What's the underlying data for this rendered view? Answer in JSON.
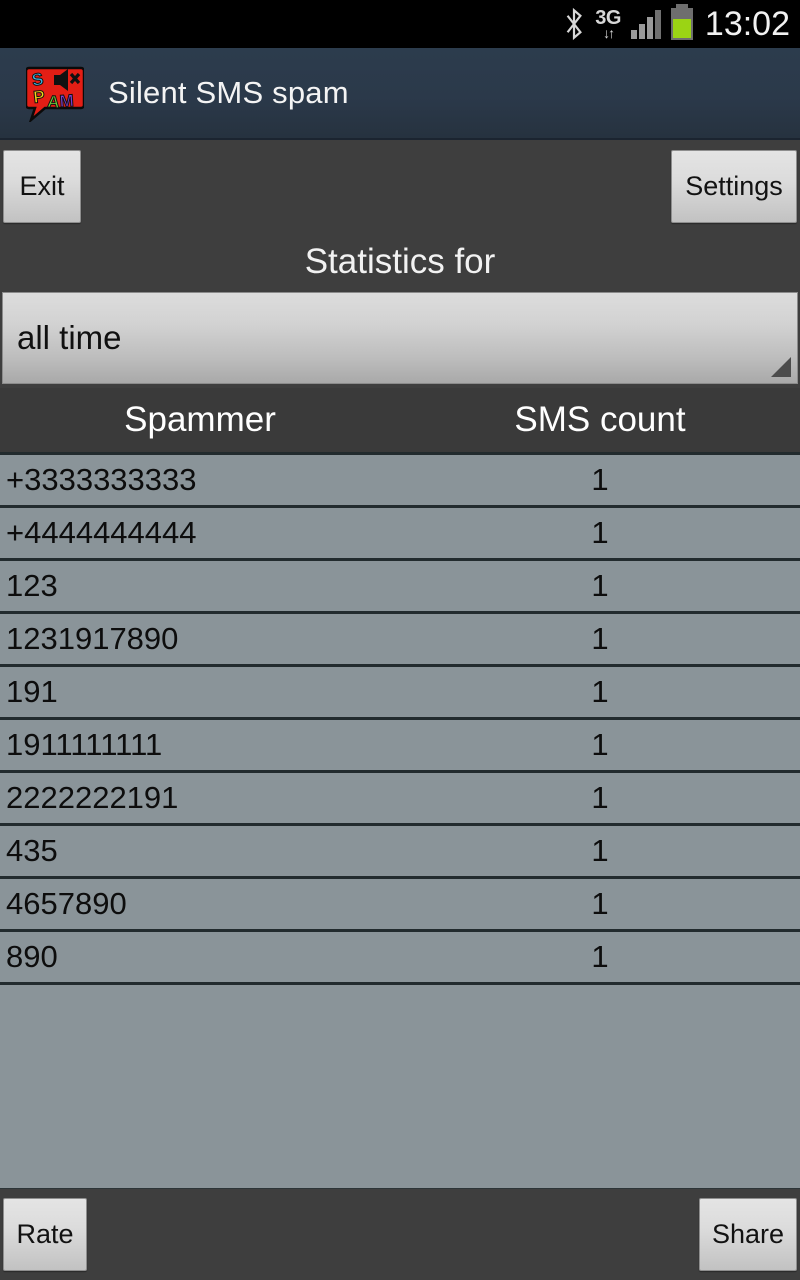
{
  "status_bar": {
    "bluetooth_icon": "bluetooth-icon",
    "network_type": "3G",
    "network_arrows": "↓↑",
    "signal_icon": "signal-bars-icon",
    "battery_icon": "battery-icon",
    "time": "13:02"
  },
  "title_bar": {
    "app_icon": "spam-app-icon",
    "title": "Silent SMS spam"
  },
  "toolbar": {
    "exit_label": "Exit",
    "settings_label": "Settings"
  },
  "stats": {
    "heading": "Statistics for",
    "period_selected": "all time",
    "dropdown_icon": "dropdown-triangle-icon"
  },
  "table": {
    "columns": [
      "Spammer",
      "SMS count"
    ],
    "rows": [
      {
        "spammer": "+3333333333",
        "count": "1"
      },
      {
        "spammer": "+4444444444",
        "count": "1"
      },
      {
        "spammer": "123",
        "count": "1"
      },
      {
        "spammer": "1231917890",
        "count": "1"
      },
      {
        "spammer": "191",
        "count": "1"
      },
      {
        "spammer": "1911111111",
        "count": "1"
      },
      {
        "spammer": "2222222191",
        "count": "1"
      },
      {
        "spammer": "435",
        "count": "1"
      },
      {
        "spammer": "4657890",
        "count": "1"
      },
      {
        "spammer": "890",
        "count": "1"
      }
    ]
  },
  "bottom_bar": {
    "rate_label": "Rate",
    "share_label": "Share"
  },
  "colors": {
    "titlebar": "#2b394a",
    "toolbar_bg": "#3e3e3e",
    "row_bg": "#8a9499",
    "row_divider": "#222b2e",
    "button_face": "#dcdcdc",
    "battery_green": "#9bd414",
    "status_bar": "#000000"
  }
}
